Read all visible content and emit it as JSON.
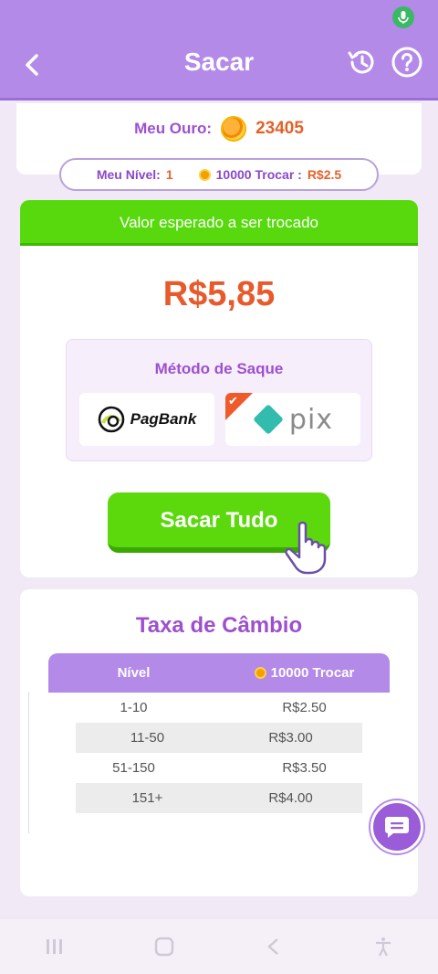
{
  "header": {
    "title": "Sacar"
  },
  "gold": {
    "label": "Meu Ouro:",
    "value": "23405"
  },
  "level": {
    "label": "Meu Nível:",
    "value": "1",
    "rate_text": "10000 Trocar :",
    "rate_value": "R$2.5"
  },
  "expected": {
    "band_text": "Valor esperado a ser trocado",
    "amount": "R$5,85"
  },
  "method": {
    "title": "Método de Saque",
    "options": [
      {
        "label": "PagBank",
        "selected": false
      },
      {
        "label": "pix",
        "selected": true
      }
    ]
  },
  "withdraw_button": "Sacar Tudo",
  "rates": {
    "title": "Taxa de Câmbio",
    "headers": [
      "Nível",
      "10000 Trocar"
    ],
    "rows": [
      [
        "1-10",
        "R$2.50"
      ],
      [
        "11-50",
        "R$3.00"
      ],
      [
        "51-150",
        "R$3.50"
      ],
      [
        "151+",
        "R$4.00"
      ]
    ]
  },
  "colors": {
    "header_bg": "#b48ae8",
    "green": "#58d90e",
    "accent_orange": "#e75a2b",
    "purple_text": "#9d4fd0"
  }
}
